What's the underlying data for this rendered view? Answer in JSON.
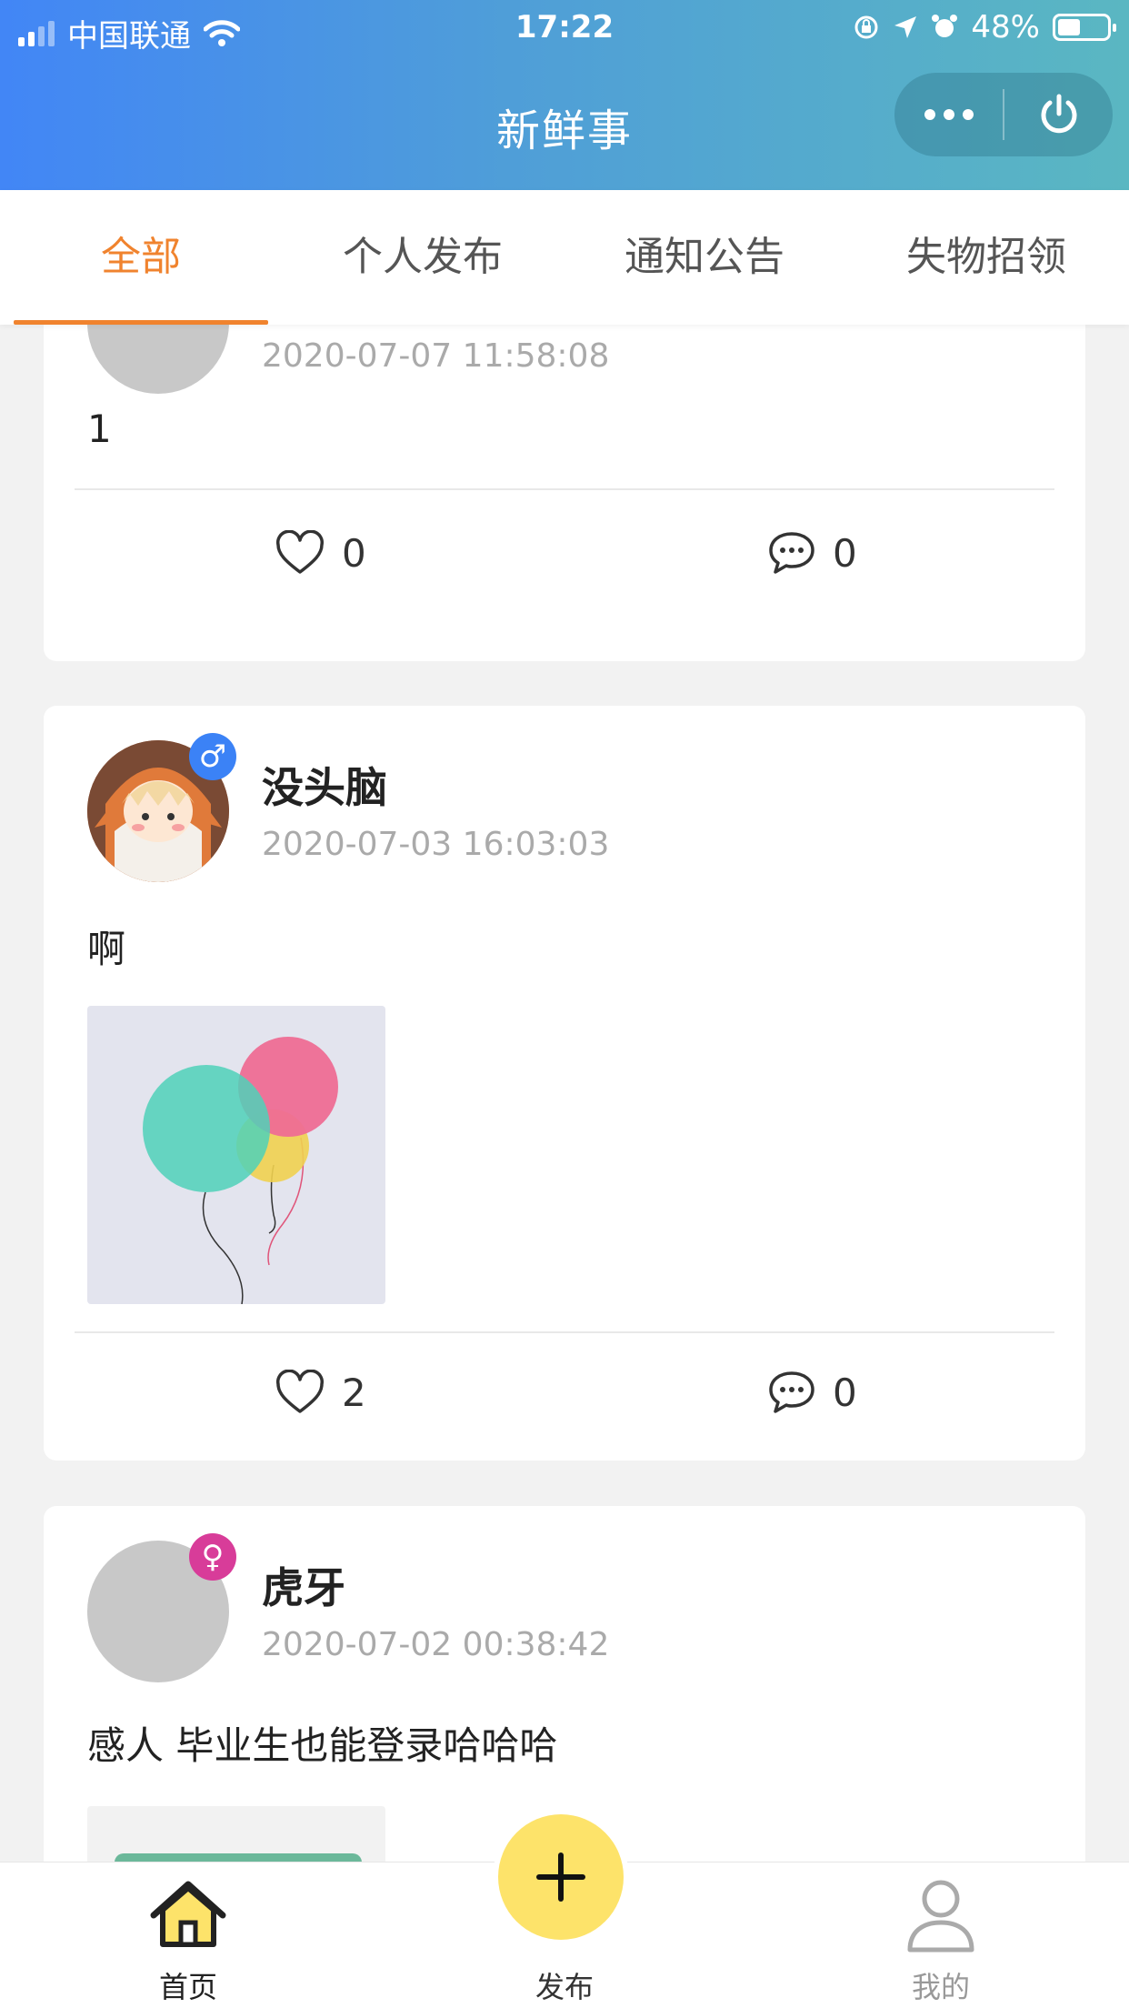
{
  "status_bar": {
    "carrier": "中国联通",
    "time": "17:22",
    "battery": "48%"
  },
  "nav": {
    "title": "新鲜事"
  },
  "tabs": [
    {
      "label": "全部",
      "active": true
    },
    {
      "label": "个人发布",
      "active": false
    },
    {
      "label": "通知公告",
      "active": false
    },
    {
      "label": "失物招领",
      "active": false
    }
  ],
  "posts": [
    {
      "username": "",
      "time": "2020-07-07 11:58:08",
      "content": "1",
      "likes": "0",
      "comments": "0"
    },
    {
      "username": "没头脑",
      "gender": "male",
      "time": "2020-07-03 16:03:03",
      "content": "啊",
      "likes": "2",
      "comments": "0",
      "has_image": true
    },
    {
      "username": "虎牙",
      "gender": "female",
      "time": "2020-07-02 00:38:42",
      "content": "感人 毕业生也能登录哈哈哈"
    }
  ],
  "bottom_nav": {
    "home": "首页",
    "publish": "发布",
    "mine": "我的"
  },
  "colors": {
    "accent": "#f0832e",
    "publish": "#fde36a",
    "male": "#3b82f6",
    "female": "#d83c99"
  }
}
